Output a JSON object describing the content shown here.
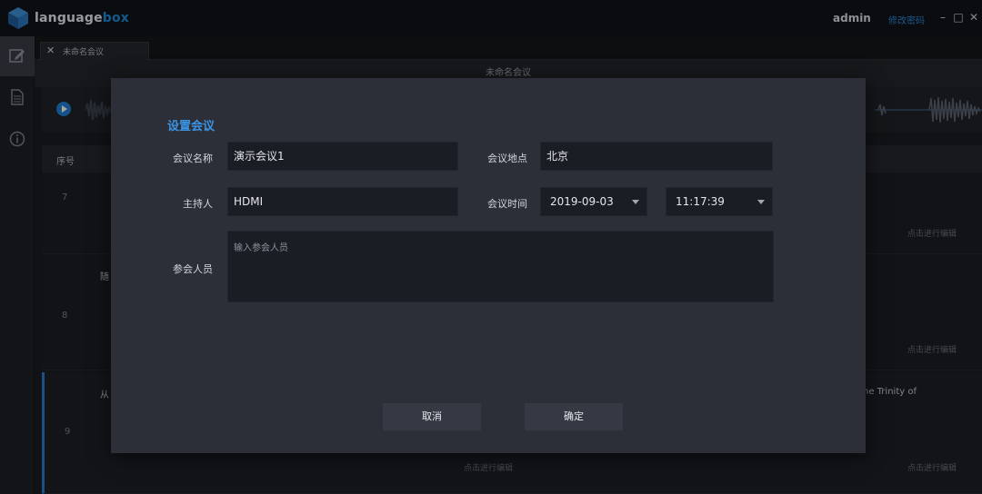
{
  "app": {
    "brand_main": "language",
    "brand_accent": "box",
    "user": "admin",
    "change_password": "修改密码",
    "accent_color": "#2b88d8"
  },
  "window_controls": {
    "minimize": "–",
    "maximize": "□",
    "close": "✕"
  },
  "tabs": [
    {
      "label": "未命名会议",
      "close": "✕"
    }
  ],
  "document": {
    "title": "未命名会议",
    "table_header": {
      "num": "序号"
    },
    "rows": [
      {
        "num": "7",
        "edit": "点击进行编辑"
      },
      {
        "num": "8",
        "text": "随",
        "edit": "点击进行编辑"
      },
      {
        "num": "9",
        "text_left": "从",
        "text_right": "he Trinity of",
        "edit_center": "点击进行编辑",
        "edit": "点击进行编辑"
      }
    ]
  },
  "modal": {
    "title": "设置会议",
    "fields": {
      "name": {
        "label": "会议名称",
        "value": "演示会议1"
      },
      "location": {
        "label": "会议地点",
        "value": "北京"
      },
      "host": {
        "label": "主持人",
        "value": "HDMI"
      },
      "time": {
        "label": "会议时间",
        "date": "2019-09-03",
        "clock": "11:17:39"
      },
      "participants": {
        "label": "参会人员",
        "placeholder": "输入参会人员"
      }
    },
    "buttons": {
      "cancel": "取消",
      "confirm": "确定"
    }
  }
}
